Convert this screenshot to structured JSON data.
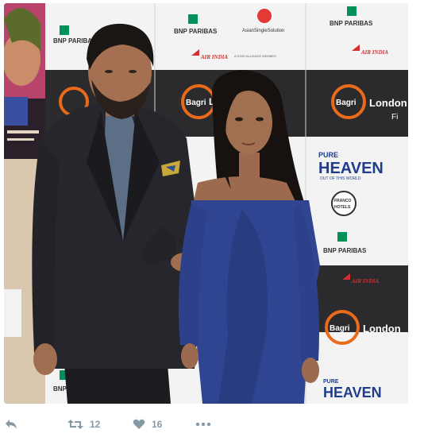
{
  "photo": {
    "alt": "",
    "wall_texts": {
      "bnp": "BNP PARIBAS",
      "asian": "AsianSingleSolution",
      "air": "AIR INDIA",
      "alliance": "A STAR ALLIANCE MEMBER",
      "bagri": "Bagri",
      "london": "London",
      "fi": "Fi",
      "pure": "PURE",
      "heaven": "HEAVEN",
      "tagline": "OUT OF THIS WORLD",
      "franco": "FRANCO",
      "hotels": "HOTELS"
    }
  },
  "actions": {
    "retweet_count": "12",
    "like_count": "16"
  },
  "colors": {
    "icon": "#8899a6",
    "like": "#8899a6"
  }
}
